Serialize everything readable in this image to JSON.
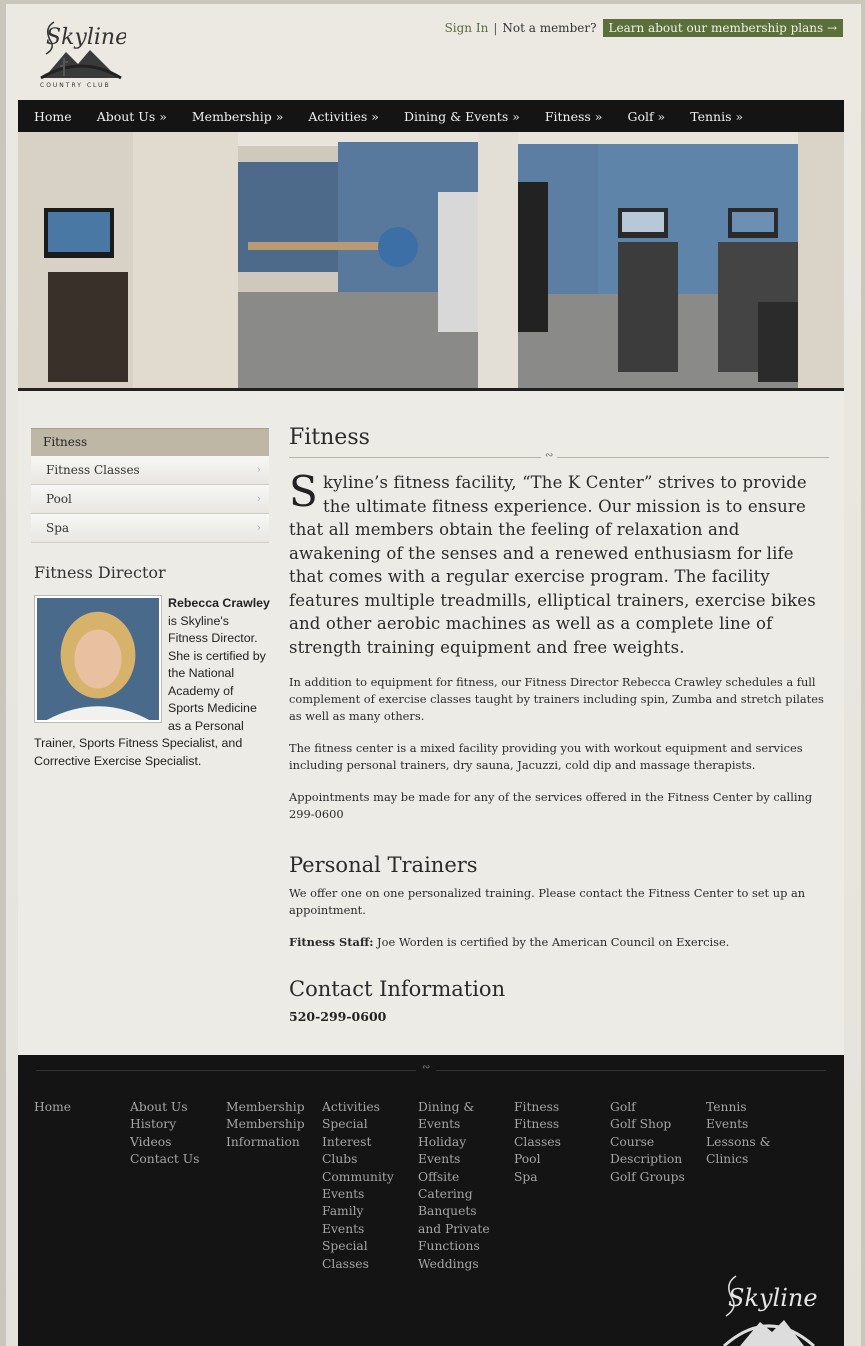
{
  "header": {
    "logo_text": "COUNTRY CLUB",
    "sign_in": "Sign In",
    "separator": "|",
    "not_member": "Not a member?",
    "membership_cta": "Learn about our membership plans →"
  },
  "nav": {
    "items": [
      "Home",
      "About Us »",
      "Membership »",
      "Activities »",
      "Dining & Events »",
      "Fitness »",
      "Golf »",
      "Tennis »"
    ]
  },
  "sidebar": {
    "heading": "Fitness",
    "items": [
      "Fitness Classes",
      "Pool",
      "Spa"
    ],
    "chevron": "›",
    "director_title": "Fitness Director",
    "director_name": "Rebecca Crawley",
    "director_bio": " is Skyline's Fitness Director. She is certified by the National Academy of Sports Medicine as a Personal Trainer, Sports Fitness Specialist, and Corrective Exercise Specialist."
  },
  "main": {
    "title": "Fitness",
    "ornament": "∾",
    "lead_dropcap": "S",
    "lead_text": "kyline’s fitness facility, “The K Center” strives to provide the ultimate fitness experience. Our mission is to ensure that all members obtain the feeling of relaxation and awakening of the senses and a renewed enthusiasm for life that comes with a regular exercise program. The facility features multiple treadmills, elliptical trainers, exercise bikes and other aerobic machines as well as a complete line of strength training equipment and free weights.",
    "para1": "In addition to equipment for fitness, our Fitness Director Rebecca Crawley schedules a full complement of exercise classes taught by trainers including spin, Zumba and stretch pilates as well as many others.",
    "para2": "The fitness center is a mixed facility providing you with workout equipment and services including personal trainers, dry sauna, Jacuzzi, cold dip and massage therapists.",
    "para3": "Appointments may be made for any of the services offered in the Fitness Center by calling 299-0600",
    "trainers_heading": "Personal Trainers",
    "trainers_text": "We offer one on one personalized training.  Please contact the Fitness Center to set up an appointment.",
    "staff_label": "Fitness Staff:",
    "staff_text": " Joe Worden is certified by the American Council on Exercise.",
    "contact_heading": "Contact Information",
    "phone": "520-299-0600"
  },
  "footer": {
    "ornament": "∾",
    "columns": [
      [
        "Home"
      ],
      [
        "About Us",
        "History",
        "Videos",
        "Contact Us"
      ],
      [
        "Membership",
        "Membership Information"
      ],
      [
        "Activities",
        "Special Interest Clubs",
        "Community Events",
        "Family Events",
        "Special Classes"
      ],
      [
        "Dining & Events",
        "Holiday Events",
        "Offsite Catering",
        "Banquets and Private Functions",
        "Weddings"
      ],
      [
        "Fitness",
        "Fitness Classes",
        "Pool",
        "Spa"
      ],
      [
        "Golf",
        "Golf Shop",
        "Course Description",
        "Golf Groups"
      ],
      [
        "Tennis",
        "Events",
        "Lessons & Clinics"
      ]
    ]
  }
}
